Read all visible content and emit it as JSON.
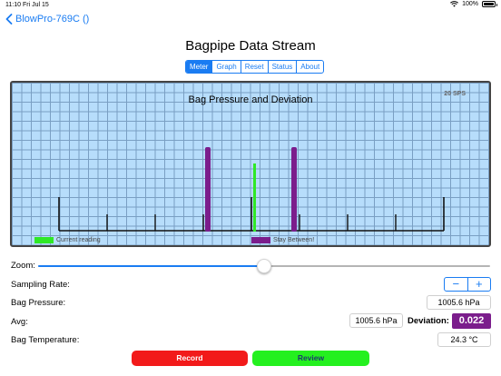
{
  "status_bar": {
    "time": "11:10",
    "date": "Fri Jul 15",
    "battery": "100%"
  },
  "nav": {
    "back_label": "BlowPro-769C ()"
  },
  "page": {
    "title": "Bagpipe Data Stream"
  },
  "tabs": [
    {
      "label": "Meter",
      "active": true
    },
    {
      "label": "Graph",
      "active": false
    },
    {
      "label": "Reset",
      "active": false
    },
    {
      "label": "Status",
      "active": false
    },
    {
      "label": "About",
      "active": false
    }
  ],
  "meter": {
    "title": "Bag Pressure and Deviation",
    "sps_label": "20 SPS",
    "legend_current": "Current reading",
    "legend_range": "Stay Between!",
    "colors": {
      "current": "#2fe826",
      "range": "#7b1d8c",
      "grid_bg": "#b7ddfb",
      "scale": "#111111"
    }
  },
  "zoom": {
    "label": "Zoom:",
    "value": 0.5
  },
  "sampling_rate": {
    "label": "Sampling Rate:",
    "decrement_icon": "minus-icon",
    "increment_icon": "plus-icon",
    "decrement_label": "−",
    "increment_label": "+"
  },
  "bag_pressure": {
    "label": "Bag Pressure:",
    "value": "1005.6 hPa"
  },
  "avg": {
    "label": "Avg:",
    "value": "1005.6 hPa",
    "deviation_label": "Deviation:",
    "deviation_value": "0.022"
  },
  "bag_temperature": {
    "label": "Bag Temperature:",
    "value": "24.3 °C"
  },
  "buttons": {
    "record": "Record",
    "review": "Review"
  },
  "accent_color": "#1a7cf2"
}
